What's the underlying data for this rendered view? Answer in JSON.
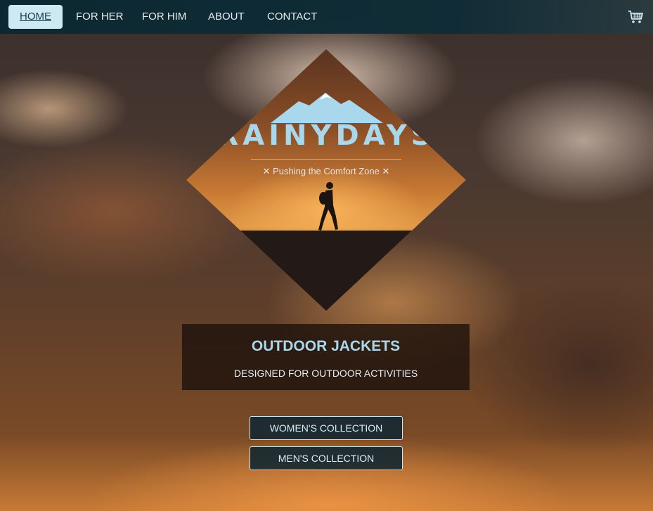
{
  "nav": {
    "items": [
      {
        "label": "HOME",
        "active": true
      },
      {
        "label": "FOR HER"
      },
      {
        "label": "FOR HIM"
      },
      {
        "label": "ABOUT"
      },
      {
        "label": "CONTACT"
      }
    ],
    "cart_icon": "shopping-cart-icon"
  },
  "logo": {
    "brand": "RAINYDAYS",
    "tagline": "✕ Pushing the Comfort Zone ✕"
  },
  "banner": {
    "title": "OUTDOOR JACKETS",
    "subtitle": "DESIGNED FOR OUTDOOR ACTIVITIES"
  },
  "buttons": {
    "women": "WOMEN'S COLLECTION",
    "men": "MEN'S COLLECTION"
  },
  "colors": {
    "accent": "#a9d8ec",
    "nav_bg": "#0f2d36",
    "active_bg": "#cfe9f3"
  }
}
